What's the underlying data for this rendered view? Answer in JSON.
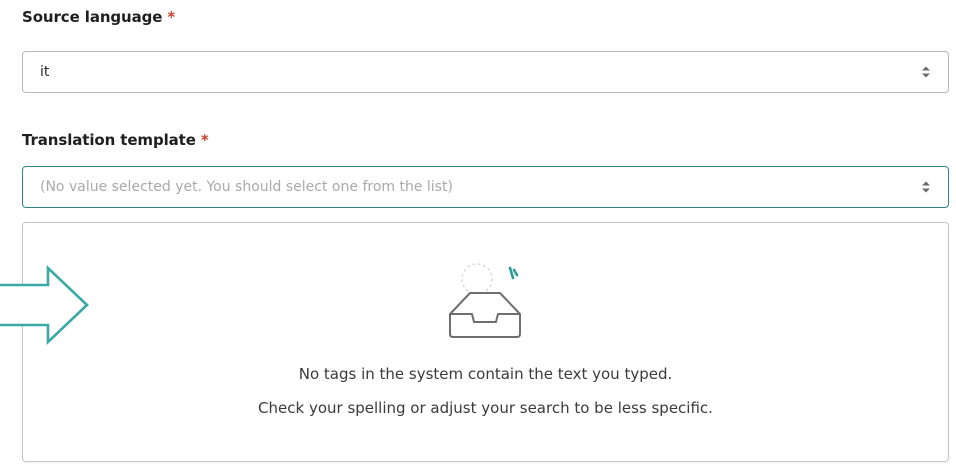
{
  "source_language": {
    "label": "Source language",
    "required_mark": "*",
    "value": "it"
  },
  "translation_template": {
    "label": "Translation template",
    "required_mark": "*",
    "placeholder": "(No value selected yet. You should select one from the list)"
  },
  "dropdown": {
    "empty_line_1": "No tags in the system contain the text you typed.",
    "empty_line_2": "Check your spelling or adjust your search to be less specific."
  },
  "colors": {
    "accent": "#2f8586",
    "arrow": "#3aa9a4",
    "required": "#c7432c"
  },
  "icons": [
    "sort-caret-icon",
    "empty-inbox-icon",
    "arrow-right-icon"
  ]
}
